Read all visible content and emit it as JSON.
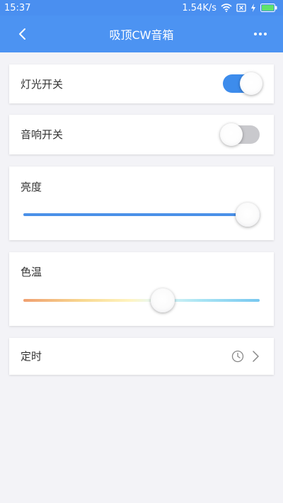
{
  "status_bar": {
    "time": "15:37",
    "network_speed": "1.54K/s",
    "icons": [
      "wifi-icon",
      "sim-error-icon",
      "charging-icon",
      "battery-icon"
    ]
  },
  "nav": {
    "title": "吸顶CW音箱",
    "back_icon": "chevron-left-icon",
    "more_icon": "more-dots-icon"
  },
  "controls": {
    "light_switch": {
      "label": "灯光开关",
      "on": true
    },
    "speaker_switch": {
      "label": "音响开关",
      "on": false
    },
    "brightness": {
      "label": "亮度",
      "value_fraction": 0.95
    },
    "color_temp": {
      "label": "色温",
      "value_fraction": 0.59
    },
    "timer": {
      "label": "定时",
      "icons": [
        "clock-icon",
        "chevron-right-icon"
      ]
    }
  },
  "colors": {
    "header": "#4c93f2",
    "switch_on": "#3d8cec",
    "switch_off": "#c9c9cd",
    "slider_blue": "#4a90e8"
  }
}
